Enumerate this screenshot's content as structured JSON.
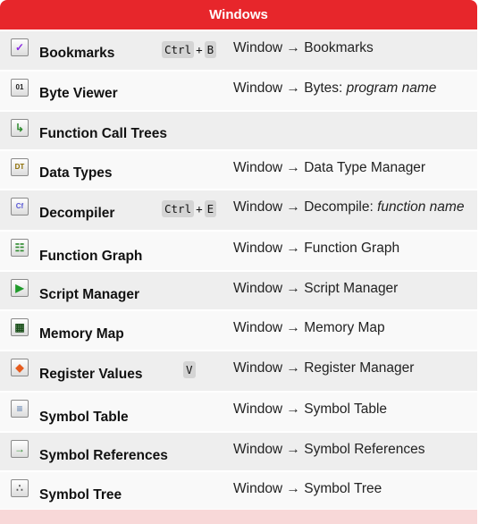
{
  "header": {
    "title": "Windows"
  },
  "rows": [
    {
      "name": "Bookmarks",
      "icon": "bookmark-check-icon",
      "keys": [
        "Ctrl",
        "B"
      ],
      "menu": "Window → Bookmarks",
      "menu_italic": ""
    },
    {
      "name": "Byte Viewer",
      "icon": "byte-viewer-icon",
      "keys": [],
      "menu": "Window → Bytes: ",
      "menu_italic": "program name"
    },
    {
      "name": "Function Call Trees",
      "icon": "call-tree-icon",
      "keys": [],
      "menu": "",
      "menu_italic": ""
    },
    {
      "name": "Data Types",
      "icon": "data-types-icon",
      "keys": [],
      "menu": "Window → Data Type Manager",
      "menu_italic": ""
    },
    {
      "name": "Decompiler",
      "icon": "decompiler-icon",
      "keys": [
        "Ctrl",
        "E"
      ],
      "menu": "Window → Decompile: ",
      "menu_italic": "function name"
    },
    {
      "name": "Function Graph",
      "icon": "function-graph-icon",
      "keys": [],
      "menu": "Window → Function Graph",
      "menu_italic": ""
    },
    {
      "name": "Script Manager",
      "icon": "script-manager-icon",
      "keys": [],
      "menu": "Window → Script Manager",
      "menu_italic": ""
    },
    {
      "name": "Memory Map",
      "icon": "memory-map-icon",
      "keys": [],
      "menu": "Window → Memory Map",
      "menu_italic": ""
    },
    {
      "name": "Register Values",
      "icon": "register-values-icon",
      "keys": [
        "V"
      ],
      "menu": "Window → Register Manager",
      "menu_italic": ""
    },
    {
      "name": "Symbol Table",
      "icon": "symbol-table-icon",
      "keys": [],
      "menu": "Window → Symbol Table",
      "menu_italic": ""
    },
    {
      "name": "Symbol References",
      "icon": "symbol-references-icon",
      "keys": [],
      "menu": "Window → Symbol References",
      "menu_italic": ""
    },
    {
      "name": "Symbol Tree",
      "icon": "symbol-tree-icon",
      "keys": [],
      "menu": "Window → Symbol Tree",
      "menu_italic": ""
    }
  ]
}
